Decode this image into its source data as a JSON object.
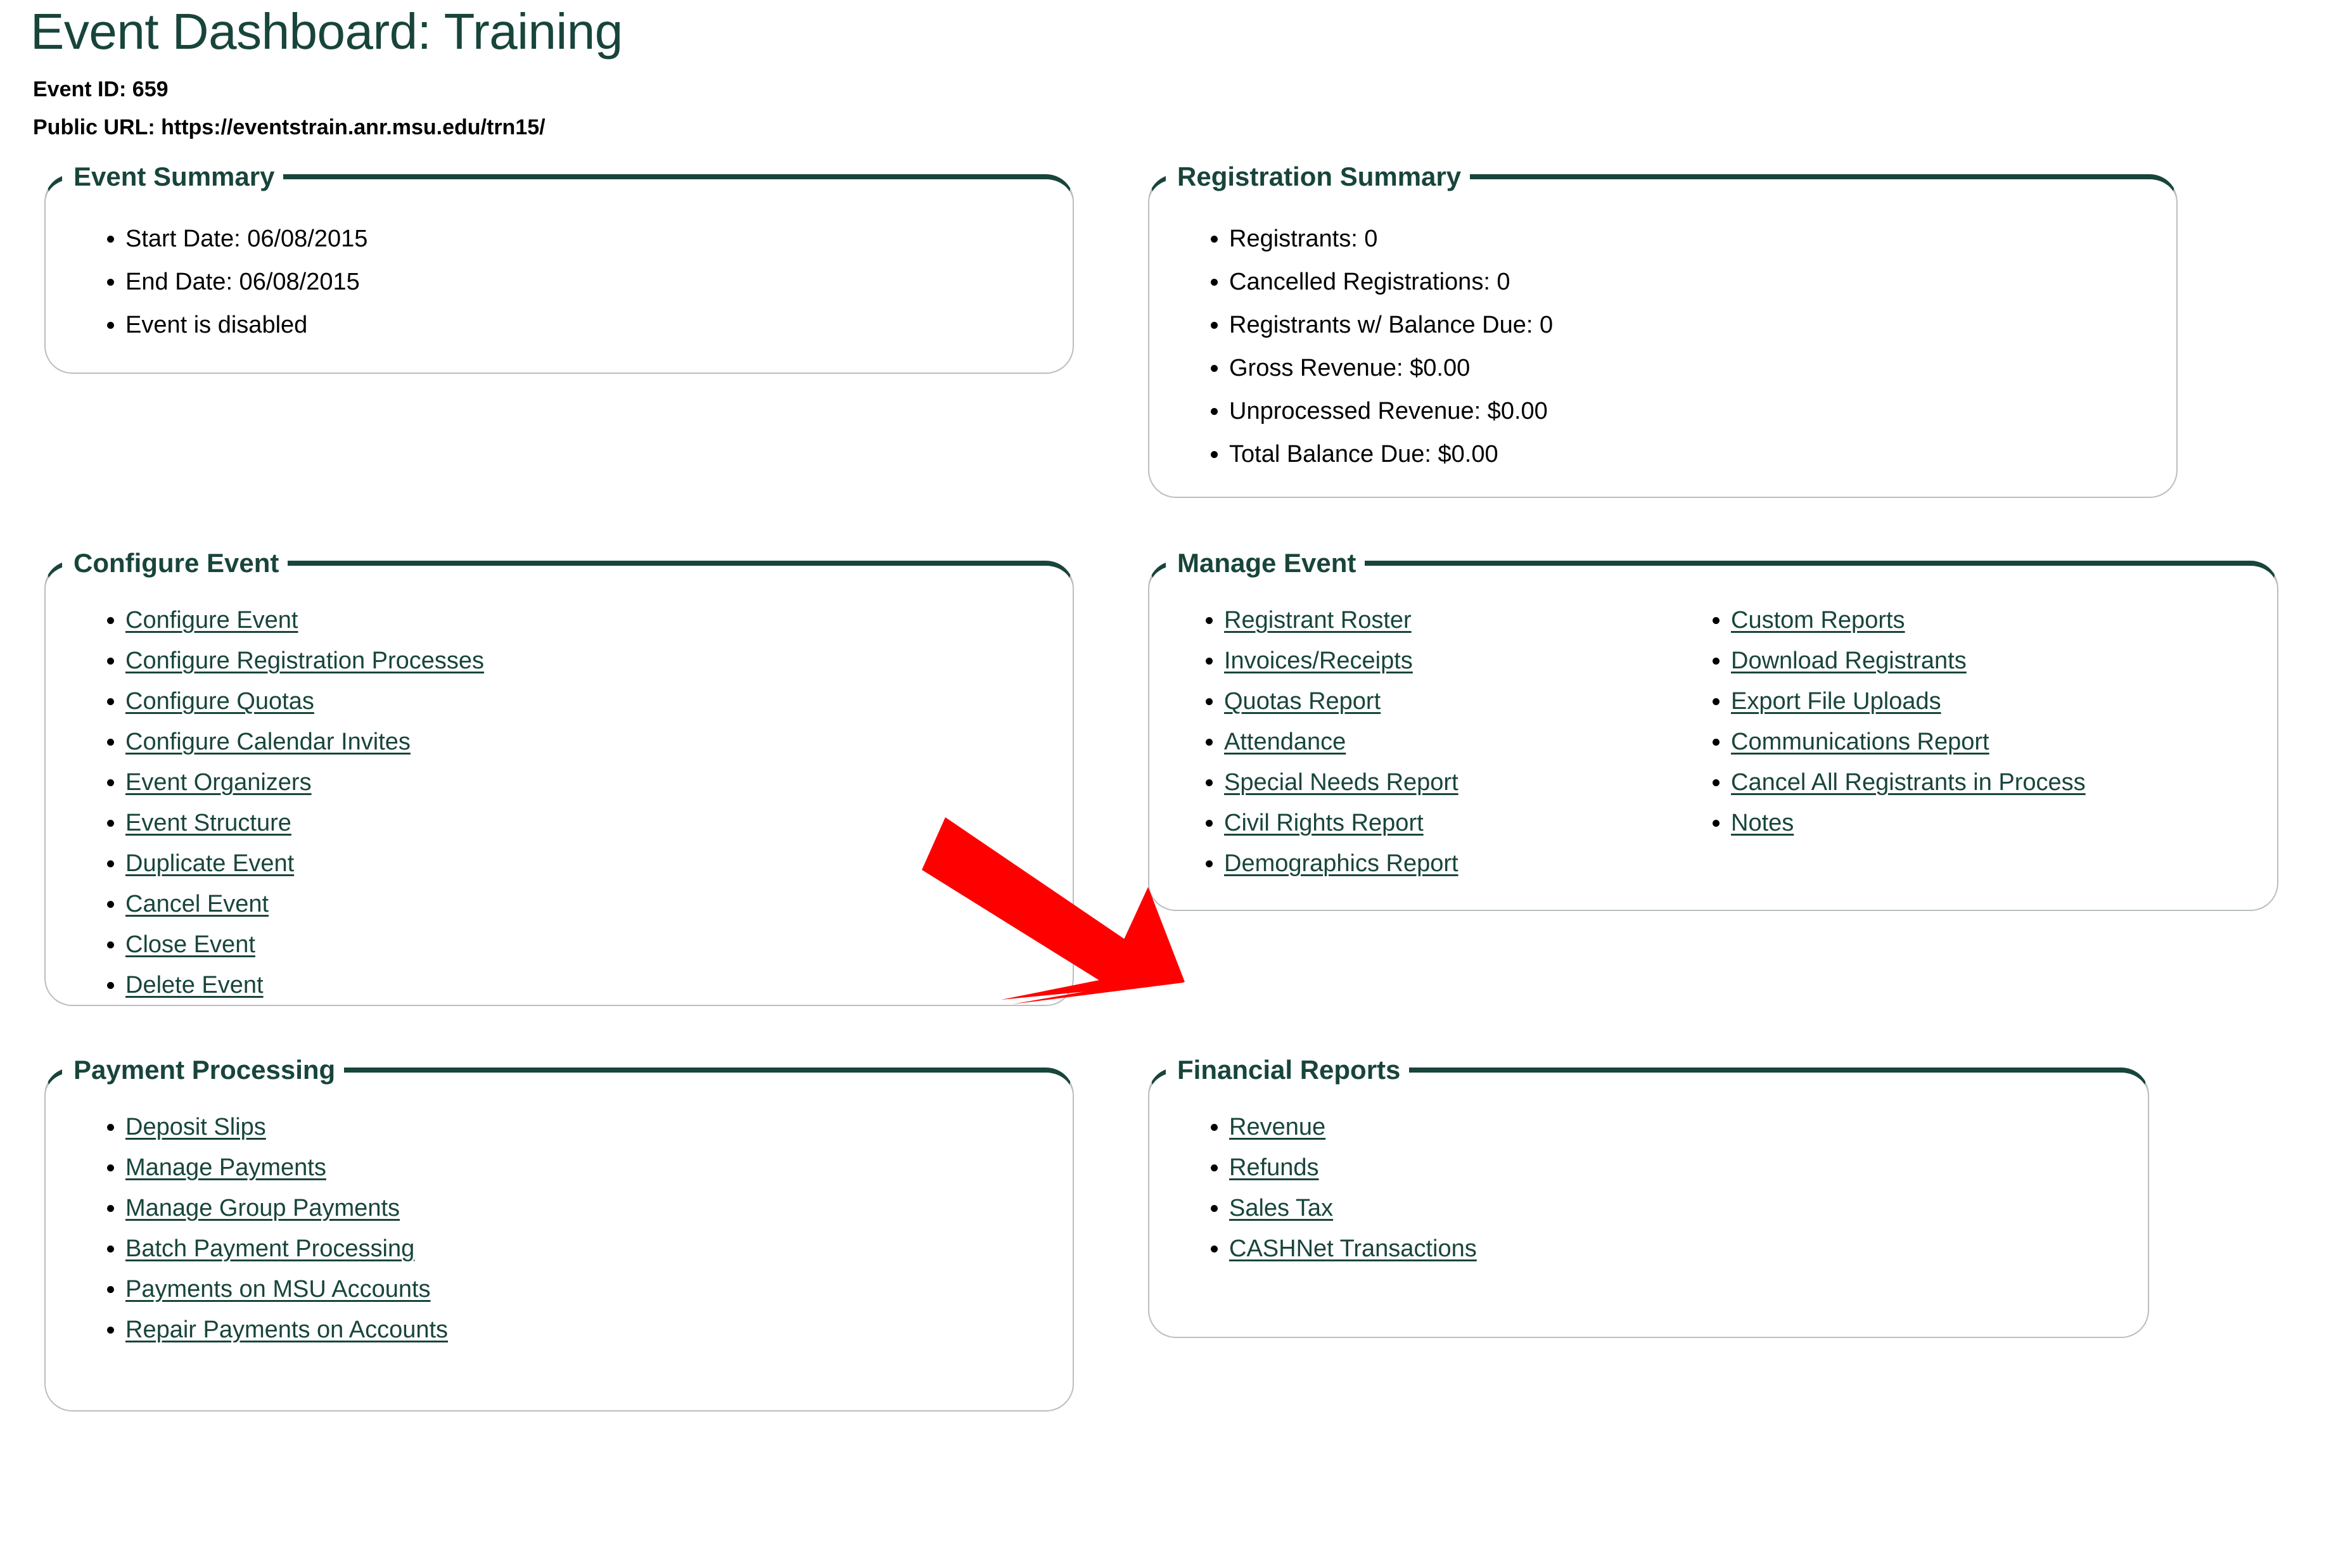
{
  "header": {
    "title": "Event Dashboard: Training",
    "event_id_line": "Event ID: 659",
    "public_url_line": "Public URL: https://eventstrain.anr.msu.edu/trn15/"
  },
  "colors": {
    "msu_green": "#18453B",
    "panel_border": "#b9bfbe",
    "annotation_red": "#FF0000",
    "text": "#000000",
    "background": "#FFFFFF"
  },
  "panels": {
    "event_summary": {
      "legend": "Event Summary",
      "items": [
        "Start Date: 06/08/2015",
        "End Date: 06/08/2015",
        "Event is disabled"
      ]
    },
    "registration_summary": {
      "legend": "Registration Summary",
      "items": [
        "Registrants: 0",
        "Cancelled Registrations: 0",
        "Registrants w/ Balance Due: 0",
        "Gross Revenue: $0.00",
        "Unprocessed Revenue: $0.00",
        "Total Balance Due: $0.00"
      ]
    },
    "configure_event": {
      "legend": "Configure Event",
      "links": [
        "Configure Event",
        "Configure Registration Processes",
        "Configure Quotas",
        "Configure Calendar Invites",
        "Event Organizers",
        "Event Structure",
        "Duplicate Event",
        "Cancel Event",
        "Close Event",
        "Delete Event"
      ]
    },
    "manage_event": {
      "legend": "Manage Event",
      "links_col1": [
        "Registrant Roster",
        "Invoices/Receipts",
        "Quotas Report",
        "Attendance",
        "Special Needs Report",
        "Civil Rights Report",
        "Demographics Report"
      ],
      "links_col2": [
        "Custom Reports",
        "Download Registrants",
        "Export File Uploads",
        "Communications Report",
        "Cancel All Registrants in Process",
        "Notes"
      ]
    },
    "payment_processing": {
      "legend": "Payment Processing",
      "links": [
        "Deposit Slips",
        "Manage Payments",
        "Manage Group Payments",
        "Batch Payment Processing",
        "Payments on MSU Accounts",
        "Repair Payments on Accounts"
      ]
    },
    "financial_reports": {
      "legend": "Financial Reports",
      "links": [
        "Revenue",
        "Refunds",
        "Sales Tax",
        "CASHNet Transactions"
      ]
    }
  },
  "annotation": {
    "arrow_icon": "arrow-down-right-icon",
    "points_to": "Demographics Report"
  }
}
